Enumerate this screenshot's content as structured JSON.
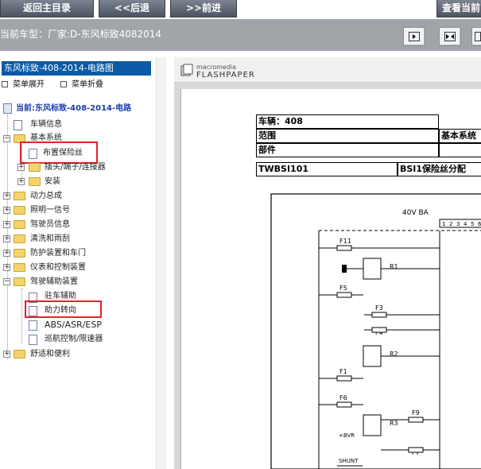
{
  "nav": {
    "back_home": "返回主目录",
    "back": "<<后退",
    "forward": ">>前进",
    "view_current": "查看当前"
  },
  "info": {
    "model_text": "当前车型：厂家:D-东风标致4082014"
  },
  "tree": {
    "title": "东风标致-408-2014-电路图",
    "expand_label": "菜单展开",
    "collapse_label": "菜单折叠",
    "root": "当前:东风标致-408-2014-电路",
    "items": [
      {
        "label": "车辆信息"
      },
      {
        "label": "基本系统"
      },
      {
        "label": "布置保险丝"
      },
      {
        "label": "插头/端子/连接器"
      },
      {
        "label": "安装"
      },
      {
        "label": "动力总成"
      },
      {
        "label": "照明一信号"
      },
      {
        "label": "驾驶员信息"
      },
      {
        "label": "清洗和雨刮"
      },
      {
        "label": "防护装置和车门"
      },
      {
        "label": "仪表和控制装置"
      },
      {
        "label": "驾驶辅助装置"
      },
      {
        "label": "驻车辅助"
      },
      {
        "label": "助力转向"
      },
      {
        "label": "ABS/ASR/ESP"
      },
      {
        "label": "巡航控制/限速器"
      },
      {
        "label": "舒适和便利"
      }
    ]
  },
  "viewer": {
    "logo_top": "macromedia",
    "logo_bottom": "FLASHPAPER"
  },
  "doc": {
    "vehicle": "车辆：408",
    "scope": "范围",
    "part": "部件",
    "scope_value": "基本系统",
    "code": "TWBSI101",
    "code_desc": "BSI1保险丝分配",
    "diagram": {
      "top_label": "40V  BA",
      "connector_pins": [
        "1",
        "2",
        "3",
        "4",
        "5",
        "6"
      ],
      "labels": [
        "F11",
        "R1",
        "F5",
        "F3",
        "F4",
        "R2",
        "F1",
        "F6",
        "R3",
        "F9",
        "+BVR",
        "F7",
        "SHUNT"
      ]
    }
  },
  "colors": {
    "title_bar": "#0a5aa8",
    "highlight": "#e2242a",
    "nav_button": "#5d6470",
    "info_bar": "#a1a5aa"
  }
}
